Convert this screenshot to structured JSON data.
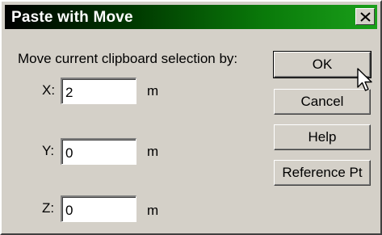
{
  "window": {
    "title": "Paste with Move",
    "close_glyph": "X"
  },
  "form": {
    "prompt": "Move current clipboard selection by:",
    "x": {
      "label": "X:",
      "value": "2",
      "unit": "m"
    },
    "y": {
      "label": "Y:",
      "value": "0",
      "unit": "m"
    },
    "z": {
      "label": "Z:",
      "value": "0",
      "unit": "m"
    }
  },
  "buttons": {
    "ok": "OK",
    "cancel": "Cancel",
    "help": "Help",
    "reference_pt": "Reference Pt"
  },
  "icons": {
    "close": "close-icon",
    "cursor": "mouse-pointer-icon"
  }
}
